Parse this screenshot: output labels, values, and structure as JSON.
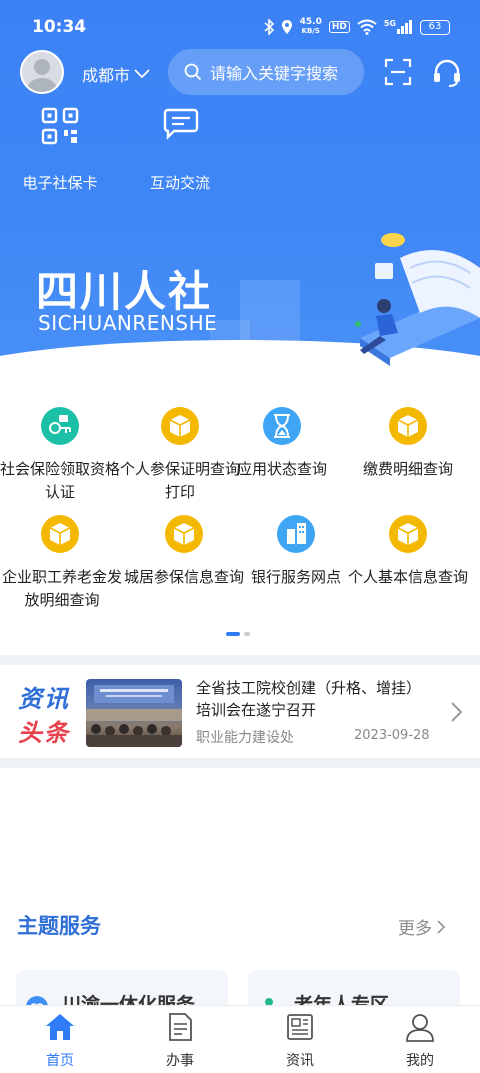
{
  "status_bar": {
    "time": "10:34",
    "net_speed_value": "45.0",
    "net_speed_unit": "KB/S",
    "hd_badge": "HD",
    "signal_label": "5G",
    "battery": "63"
  },
  "header": {
    "city": "成都市",
    "search_placeholder": "请输入关键字搜索"
  },
  "quick_actions": [
    {
      "label": "电子社保卡",
      "icon": "qr-code-icon"
    },
    {
      "label": "互动交流",
      "icon": "chat-icon"
    }
  ],
  "banner": {
    "title_cn": "四川人社",
    "title_en": "SICHUANRENSHE"
  },
  "services": [
    {
      "label": "社会保险领取资格认证",
      "icon": "certification-icon",
      "color": "#1cc0a6"
    },
    {
      "label": "个人参保证明查询打印",
      "icon": "box-icon",
      "color": "#f5b800"
    },
    {
      "label": "应用状态查询",
      "icon": "hourglass-icon",
      "color": "#3fa5f5"
    },
    {
      "label": "缴费明细查询",
      "icon": "box-icon",
      "color": "#f5b800"
    },
    {
      "label": "企业职工养老金发放明细查询",
      "icon": "box-icon",
      "color": "#f5b800"
    },
    {
      "label": "城居参保信息查询",
      "icon": "box-icon",
      "color": "#f5b800"
    },
    {
      "label": "银行服务网点",
      "icon": "building-icon",
      "color": "#3fa5f5"
    },
    {
      "label": "个人基本信息查询",
      "icon": "box-icon",
      "color": "#f5b800"
    }
  ],
  "news": {
    "tag_line1": "资讯",
    "tag_line2": "头条",
    "title": "全省技工院校创建（升格、增挂）培训会在遂宁召开",
    "source": "职业能力建设处",
    "date": "2023-09-28"
  },
  "theme": {
    "title": "主题服务",
    "more": "更多",
    "cards": [
      {
        "label": "川渝一体化服务",
        "icon": "link-icon",
        "color": "#3f8ef5"
      },
      {
        "label": "老年人专区",
        "icon": "elder-icon",
        "color": "#21b98a"
      }
    ]
  },
  "bottom_nav": [
    {
      "label": "首页",
      "icon": "home-icon",
      "active": true
    },
    {
      "label": "办事",
      "icon": "document-icon",
      "active": false
    },
    {
      "label": "资讯",
      "icon": "newspaper-icon",
      "active": false
    },
    {
      "label": "我的",
      "icon": "user-icon",
      "active": false
    }
  ],
  "colors": {
    "primary": "#2f7cf6",
    "header_blue": "#3e86f6",
    "news_red": "#e8424f"
  }
}
